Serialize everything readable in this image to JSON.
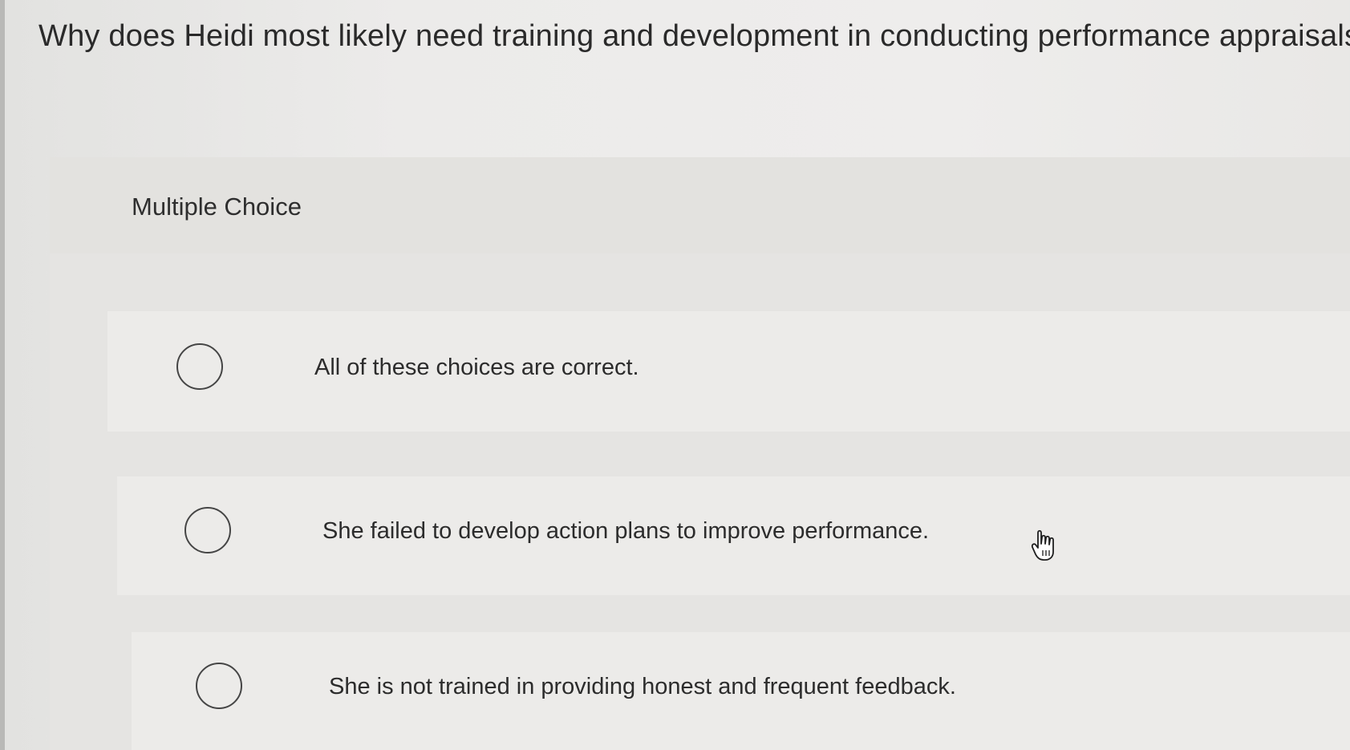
{
  "question": {
    "text": "Why does Heidi most likely need training and development in conducting performance appraisals"
  },
  "panel": {
    "type_label": "Multiple Choice"
  },
  "choices": [
    {
      "text": "All of these choices are correct.",
      "selected": false
    },
    {
      "text": "She failed to develop action plans to improve performance.",
      "selected": false
    },
    {
      "text": "She is not trained in providing honest and frequent feedback.",
      "selected": false
    }
  ],
  "icons": {
    "radio": "radio-empty-icon",
    "cursor": "hand-pointer-icon"
  },
  "colors": {
    "background": "#ecebea",
    "panel": "#e5e4e2",
    "choice_row": "#ecebe9",
    "text": "#2b2b2b",
    "radio_border": "#454545"
  }
}
